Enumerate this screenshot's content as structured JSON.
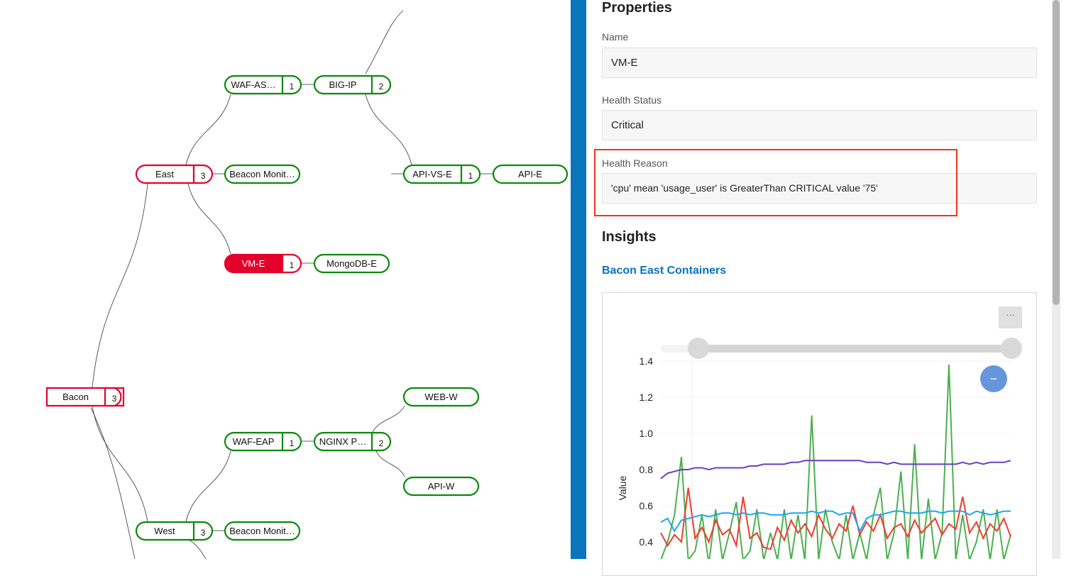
{
  "tree": {
    "nodes": [
      {
        "id": "bacon",
        "label": "Bacon",
        "count": "3",
        "status": "critical"
      },
      {
        "id": "east",
        "label": "East",
        "count": "3",
        "status": "critical"
      },
      {
        "id": "waf-as",
        "label": "WAF-AS…",
        "count": "1",
        "status": "healthy"
      },
      {
        "id": "big-ip",
        "label": "BIG-IP",
        "count": "2",
        "status": "healthy"
      },
      {
        "id": "api-vs-e",
        "label": "API-VS-E",
        "count": "1",
        "status": "healthy"
      },
      {
        "id": "api-e",
        "label": "API-E",
        "count": "",
        "status": "healthy"
      },
      {
        "id": "beacon-e",
        "label": "Beacon Monit…",
        "count": "",
        "status": "healthy"
      },
      {
        "id": "vm-e",
        "label": "VM-E",
        "count": "1",
        "status": "selected"
      },
      {
        "id": "mongodb-e",
        "label": "MongoDB-E",
        "count": "",
        "status": "healthy"
      },
      {
        "id": "web-w",
        "label": "WEB-W",
        "count": "",
        "status": "healthy"
      },
      {
        "id": "waf-eap",
        "label": "WAF-EAP",
        "count": "1",
        "status": "healthy"
      },
      {
        "id": "nginx",
        "label": "NGINX P…",
        "count": "2",
        "status": "healthy"
      },
      {
        "id": "api-w",
        "label": "API-W",
        "count": "",
        "status": "healthy"
      },
      {
        "id": "west",
        "label": "West",
        "count": "3",
        "status": "healthy"
      },
      {
        "id": "beacon-w",
        "label": "Beacon Monit…",
        "count": "",
        "status": "healthy"
      }
    ],
    "colors": {
      "critical": "#e4002b",
      "healthy": "#0a8a0a"
    }
  },
  "properties": {
    "title": "Properties",
    "name_label": "Name",
    "name_value": "VM-E",
    "health_status_label": "Health Status",
    "health_status_value": "Critical",
    "health_reason_label": "Health Reason",
    "health_reason_value": "'cpu' mean 'usage_user' is GreaterThan CRITICAL value '75'"
  },
  "insights": {
    "title": "Insights",
    "link": "Bacon East Containers",
    "more_label": "···",
    "zoom_out_label": "−"
  },
  "chart_data": {
    "type": "line",
    "ylabel": "Value",
    "yticks": [
      "1.4",
      "1.2",
      "1.0",
      "0.8",
      "0.6",
      "0.4"
    ],
    "ylim": [
      0.35,
      1.4
    ],
    "grid": true,
    "series": [
      {
        "color": "#6a3fbf",
        "values": [
          0.75,
          0.78,
          0.79,
          0.8,
          0.8,
          0.81,
          0.81,
          0.8,
          0.81,
          0.81,
          0.81,
          0.81,
          0.81,
          0.82,
          0.82,
          0.83,
          0.83,
          0.83,
          0.83,
          0.84,
          0.84,
          0.85,
          0.85,
          0.85,
          0.85,
          0.85,
          0.85,
          0.85,
          0.85,
          0.85,
          0.84,
          0.84,
          0.84,
          0.83,
          0.84,
          0.83,
          0.83,
          0.83,
          0.83,
          0.83,
          0.83,
          0.83,
          0.83,
          0.83,
          0.84,
          0.83,
          0.84,
          0.83,
          0.84,
          0.84,
          0.84,
          0.85
        ]
      },
      {
        "color": "#1aa7f0",
        "values": [
          0.51,
          0.53,
          0.46,
          0.52,
          0.53,
          0.54,
          0.55,
          0.54,
          0.55,
          0.56,
          0.56,
          0.55,
          0.56,
          0.55,
          0.56,
          0.56,
          0.55,
          0.55,
          0.55,
          0.56,
          0.56,
          0.56,
          0.57,
          0.56,
          0.57,
          0.57,
          0.55,
          0.56,
          0.56,
          0.46,
          0.53,
          0.55,
          0.55,
          0.56,
          0.57,
          0.57,
          0.56,
          0.56,
          0.56,
          0.57,
          0.57,
          0.56,
          0.57,
          0.57,
          0.57,
          0.55,
          0.57,
          0.56,
          0.55,
          0.56,
          0.57,
          0.57
        ]
      },
      {
        "color": "#f23b2e",
        "values": [
          0.45,
          0.38,
          0.44,
          0.4,
          0.7,
          0.42,
          0.48,
          0.4,
          0.52,
          0.44,
          0.47,
          0.38,
          0.65,
          0.42,
          0.45,
          0.37,
          0.36,
          0.48,
          0.41,
          0.52,
          0.45,
          0.5,
          0.43,
          0.55,
          0.47,
          0.42,
          0.5,
          0.46,
          0.6,
          0.44,
          0.51,
          0.46,
          0.55,
          0.42,
          0.48,
          0.5,
          0.43,
          0.52,
          0.45,
          0.49,
          0.53,
          0.44,
          0.5,
          0.47,
          0.65,
          0.45,
          0.51,
          0.42,
          0.5,
          0.46,
          0.53,
          0.43
        ]
      },
      {
        "color": "#4caf50",
        "values": [
          0.3,
          0.4,
          0.55,
          0.87,
          0.3,
          0.35,
          0.55,
          0.28,
          0.58,
          0.3,
          0.45,
          0.62,
          0.3,
          0.35,
          0.58,
          0.3,
          0.45,
          0.3,
          0.58,
          0.3,
          0.55,
          0.3,
          1.1,
          0.3,
          0.58,
          0.4,
          0.3,
          0.55,
          0.3,
          0.45,
          0.3,
          0.55,
          0.7,
          0.3,
          0.45,
          0.79,
          0.3,
          0.94,
          0.3,
          0.64,
          0.3,
          0.45,
          1.38,
          0.3,
          0.55,
          0.3,
          0.4,
          0.58,
          0.3,
          0.58,
          0.3,
          0.44
        ]
      }
    ]
  }
}
